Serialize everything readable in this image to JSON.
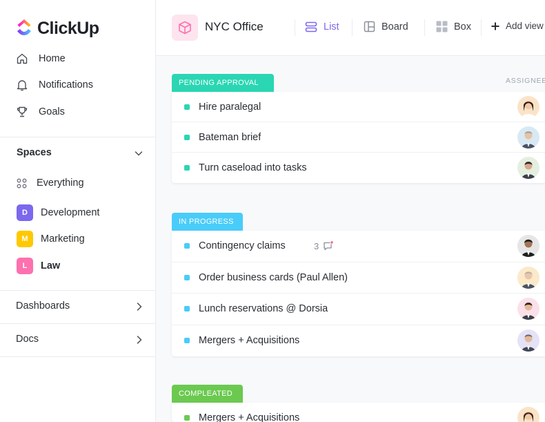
{
  "brand": {
    "name": "ClickUp"
  },
  "sidebar": {
    "nav": [
      {
        "label": "Home",
        "icon": "home-icon"
      },
      {
        "label": "Notifications",
        "icon": "bell-icon"
      },
      {
        "label": "Goals",
        "icon": "trophy-icon"
      }
    ],
    "spaces_title": "Spaces",
    "spaces": [
      {
        "label": "Everything",
        "icon": "grid-dots-icon"
      },
      {
        "label": "Development",
        "badge": "D",
        "color": "#7b68ee"
      },
      {
        "label": "Marketing",
        "badge": "M",
        "color": "#ffc800"
      },
      {
        "label": "Law",
        "badge": "L",
        "color": "#fd71af",
        "active": true
      }
    ],
    "sections": [
      {
        "label": "Dashboards"
      },
      {
        "label": "Docs"
      }
    ]
  },
  "header": {
    "title": "NYC Office",
    "views": [
      {
        "label": "List",
        "icon": "list-icon",
        "active": true
      },
      {
        "label": "Board",
        "icon": "board-icon"
      },
      {
        "label": "Box",
        "icon": "box-icon"
      }
    ],
    "add_view": "Add view"
  },
  "columns": {
    "assignee": "ASSIGNEE"
  },
  "groups": [
    {
      "label": "PENDING APPROVAL",
      "color": "#2ad6b3",
      "tasks": [
        {
          "name": "Hire paralegal"
        },
        {
          "name": "Bateman brief"
        },
        {
          "name": "Turn caseload into tasks"
        }
      ]
    },
    {
      "label": "IN PROGRESS",
      "color": "#49ccf9",
      "tasks": [
        {
          "name": "Contingency claims",
          "comments": "3"
        },
        {
          "name": "Order business cards (Paul Allen)"
        },
        {
          "name": "Lunch reservations @ Dorsia"
        },
        {
          "name": "Mergers + Acquisitions"
        }
      ]
    },
    {
      "label": "COMPLEATED",
      "color": "#6bc950",
      "tasks": [
        {
          "name": "Mergers + Acquisitions"
        }
      ]
    }
  ]
}
